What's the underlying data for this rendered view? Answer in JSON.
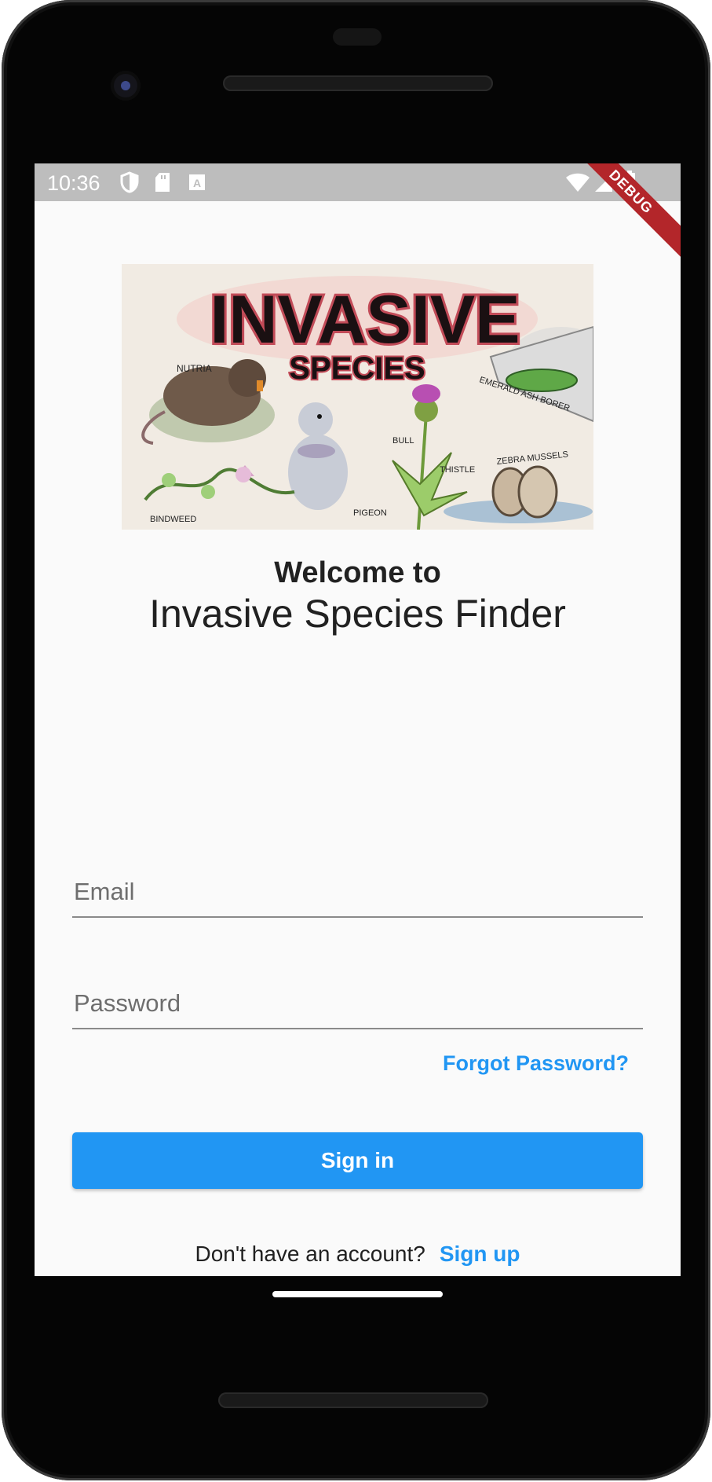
{
  "status_bar": {
    "time": "10:36",
    "icons": [
      "shield-icon",
      "sd-card-icon",
      "accessibility-a-icon",
      "wifi-icon",
      "signal-icon",
      "battery-icon"
    ]
  },
  "debug_banner": "DEBUG",
  "hero_image": {
    "title_text": "INVASIVE",
    "subtitle_text": "SPECIES",
    "labels": [
      "NUTRIA",
      "EMERALD ASH BORER",
      "BULL",
      "THISTLE",
      "ZEBRA MUSSELS",
      "BINDWEED",
      "PIGEON"
    ]
  },
  "welcome": {
    "line1": "Welcome to",
    "line2": "Invasive Species Finder"
  },
  "form": {
    "email_placeholder": "Email",
    "password_placeholder": "Password",
    "forgot_label": "Forgot Password?",
    "signin_label": "Sign in"
  },
  "footer": {
    "prompt": "Don't have an account?",
    "signup_label": "Sign up"
  },
  "colors": {
    "accent": "#2196f3",
    "debug_red": "#b3262a",
    "background": "#fafafa",
    "statusbar": "#bdbdbd"
  }
}
